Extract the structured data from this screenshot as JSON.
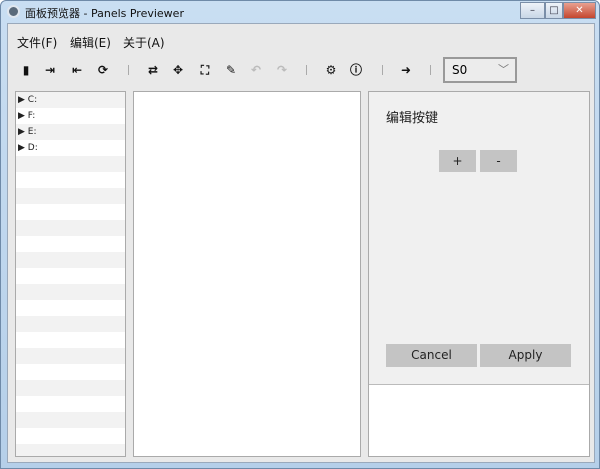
{
  "window": {
    "title": "面板预览器 - Panels Previewer",
    "minimize": "–",
    "maximize": "□",
    "close": "✕"
  },
  "menu": [
    {
      "label": "文件(F)"
    },
    {
      "label": "编辑(E)"
    },
    {
      "label": "关于(A)"
    }
  ],
  "toolbar": {
    "icons": [
      "new-file",
      "import",
      "export",
      "refresh",
      "swap",
      "move",
      "fullscreen",
      "edit",
      "undo",
      "redo",
      "settings",
      "info",
      "exit"
    ],
    "glyphs": [
      "▮",
      "⇥",
      "⇤",
      "⟳",
      "⇄",
      "✥",
      "⛶",
      "✎",
      "↶",
      "↷",
      "⚙",
      "ⓘ",
      "➜"
    ]
  },
  "combo": {
    "value": "S0",
    "chevron": "﹀"
  },
  "tree": {
    "items": [
      {
        "label": "C:"
      },
      {
        "label": "F:"
      },
      {
        "label": "E:"
      },
      {
        "label": "D:"
      }
    ],
    "arrow": "▶"
  },
  "editor": {
    "title": "编辑按键",
    "plus": "+",
    "minus": "-",
    "cancel": "Cancel",
    "apply": "Apply"
  }
}
